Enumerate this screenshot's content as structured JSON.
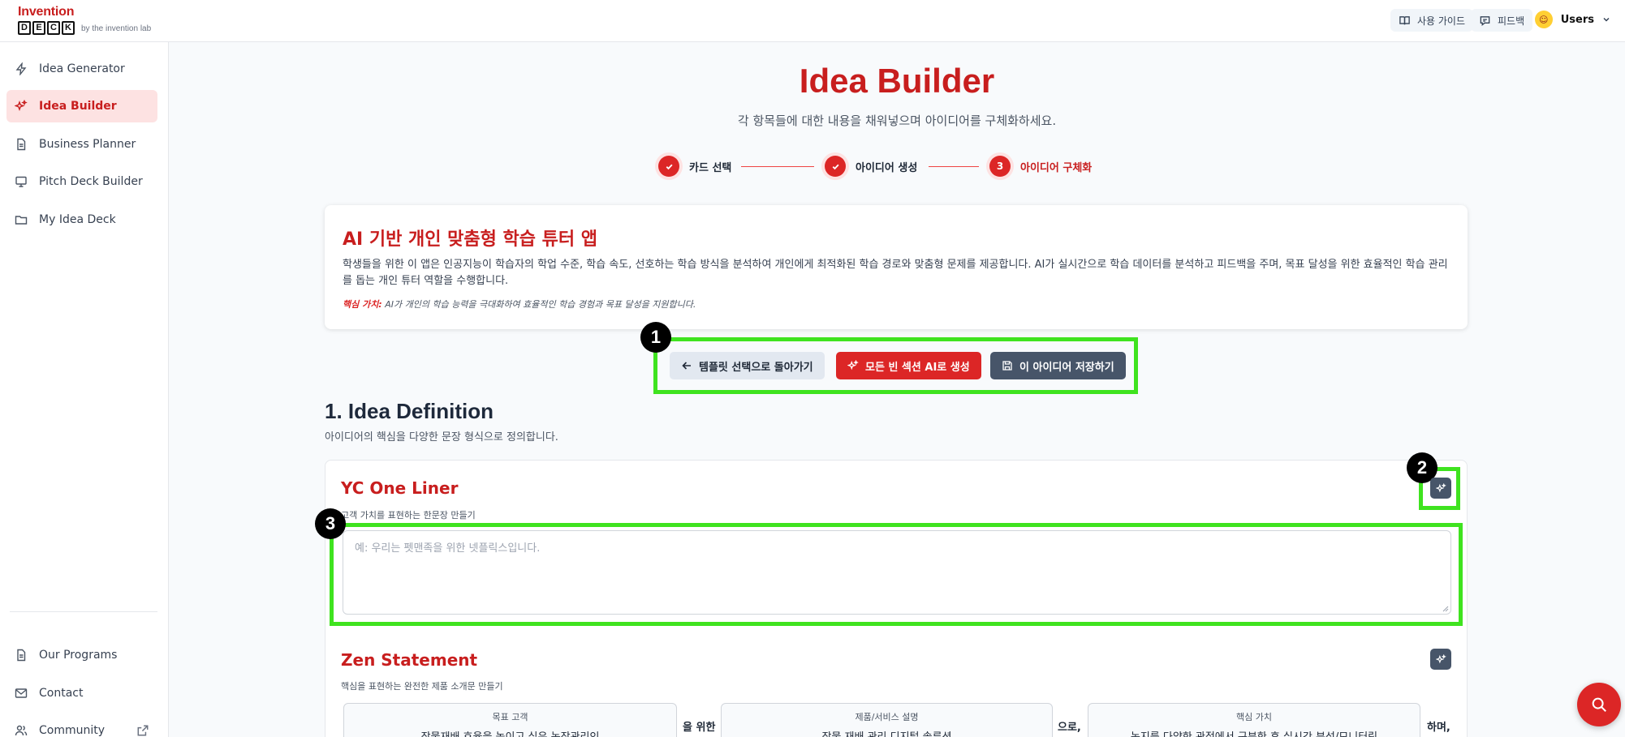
{
  "header": {
    "logo_text": "Invention",
    "logo_letters": [
      "D",
      "E",
      "C",
      "K"
    ],
    "logo_tagline": "by the invention lab",
    "guide_label": "사용 가이드",
    "feedback_label": "피드백",
    "user_label": "Users"
  },
  "sidebar": {
    "items": [
      {
        "label": "Idea Generator",
        "icon": "bolt-icon"
      },
      {
        "label": "Idea Builder",
        "icon": "sparkles-icon",
        "active": true
      },
      {
        "label": "Business Planner",
        "icon": "document-icon"
      },
      {
        "label": "Pitch Deck Builder",
        "icon": "monitor-icon"
      },
      {
        "label": "My Idea Deck",
        "icon": "folder-icon"
      }
    ],
    "bottom_items": [
      {
        "label": "Our Programs",
        "icon": "document-icon"
      },
      {
        "label": "Contact",
        "icon": "mail-icon"
      },
      {
        "label": "Community",
        "icon": "users-icon"
      }
    ]
  },
  "main": {
    "title": "Idea Builder",
    "subtitle": "각 항목들에 대한 내용을 채워넣으며 아이디어를 구체화하세요.",
    "steps": [
      {
        "label": "카드 선택",
        "status": "done"
      },
      {
        "label": "아이디어 생성",
        "status": "done"
      },
      {
        "number": "3",
        "label": "아이디어 구체화",
        "status": "current"
      }
    ]
  },
  "idea": {
    "title": "AI 기반 개인 맞춤형 학습 튜터 앱",
    "description": "학생들을 위한 이 앱은 인공지능이 학습자의 학업 수준, 학습 속도, 선호하는 학습 방식을 분석하여 개인에게 최적화된 학습 경로와 맞춤형 문제를 제공합니다. AI가 실시간으로 학습 데이터를 분석하고 피드백을 주며, 목표 달성을 위한 효율적인 학습 관리를 돕는 개인 튜터 역할을 수행합니다.",
    "core_label": "핵심 가치:",
    "core_value": "AI가 개인의 학습 능력을 극대화하여 효율적인 학습 경험과 목표 달성을 지원합니다."
  },
  "actions": {
    "back_label": "템플릿 선택으로 돌아가기",
    "generate_label": "모든 빈 섹션 AI로 생성",
    "save_label": "이 아이디어 저장하기"
  },
  "markers": [
    "1",
    "2",
    "3"
  ],
  "section": {
    "title": "1. Idea Definition",
    "subtitle": "아이디어의 핵심을 다양한 문장 형식으로 정의합니다.",
    "yc": {
      "title": "YC One Liner",
      "subtitle": "고객 가치를 표현하는 한문장 만들기",
      "placeholder": "예: 우리는 펫맨족을 위한 넷플릭스입니다."
    },
    "zen": {
      "title": "Zen Statement",
      "subtitle": "핵심을 표현하는 완전한 제품 소개문 만들기",
      "boxes": [
        {
          "label": "목표 고객",
          "value": "작물재배 효율을 높이고 싶은 농장관리인"
        },
        {
          "label": "제품/서비스 설명",
          "value": "작물 재배 관리 디지털 솔루션"
        },
        {
          "label": "핵심 가치",
          "value": "농지를 다양한 관점에서 구분한 후 실시간 분석/모니터링"
        }
      ],
      "connectors": [
        "을 위한",
        "으로,",
        "하며,"
      ]
    }
  },
  "colors": {
    "accent": "#dc2626",
    "highlight": "#3fe31f",
    "dark_button": "#475569"
  }
}
